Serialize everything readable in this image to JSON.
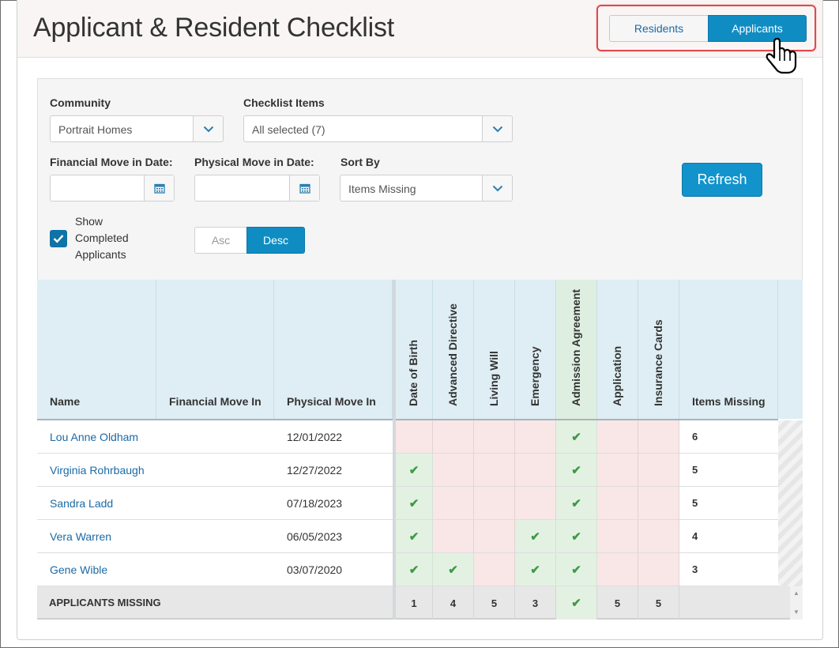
{
  "page_title": "Applicant & Resident Checklist",
  "view_toggle": {
    "residents": "Residents",
    "applicants": "Applicants",
    "active": "Applicants"
  },
  "filters": {
    "community_label": "Community",
    "community_value": "Portrait Homes",
    "checklist_label": "Checklist Items",
    "checklist_value": "All selected (7)",
    "financial_label": "Financial Move in Date:",
    "financial_value": "",
    "physical_label": "Physical Move in Date:",
    "physical_value": "",
    "sortby_label": "Sort By",
    "sortby_value": "Items Missing",
    "show_completed_label": "Show Completed Applicants",
    "show_completed_checked": true,
    "asc_label": "Asc",
    "desc_label": "Desc",
    "sort_active": "Desc",
    "refresh_label": "Refresh"
  },
  "table": {
    "columns": {
      "name": "Name",
      "financial": "Financial Move In",
      "physical": "Physical Move In",
      "items_missing": "Items Missing"
    },
    "checklist_columns": [
      "Date of Birth",
      "Advanced Directive",
      "Living Will",
      "Emergency",
      "Admission Agreement",
      "Application",
      "Insurance Cards"
    ],
    "rows": [
      {
        "name": "Lou Anne Oldham",
        "financial": "",
        "physical": "12/01/2022",
        "checks": [
          false,
          false,
          false,
          false,
          true,
          false,
          false
        ],
        "missing": "6"
      },
      {
        "name": "Virginia Rohrbaugh",
        "financial": "",
        "physical": "12/27/2022",
        "checks": [
          true,
          false,
          false,
          false,
          true,
          false,
          false
        ],
        "missing": "5"
      },
      {
        "name": "Sandra Ladd",
        "financial": "",
        "physical": "07/18/2023",
        "checks": [
          true,
          false,
          false,
          false,
          true,
          false,
          false
        ],
        "missing": "5"
      },
      {
        "name": "Vera Warren",
        "financial": "",
        "physical": "06/05/2023",
        "checks": [
          true,
          false,
          false,
          true,
          true,
          false,
          false
        ],
        "missing": "4"
      },
      {
        "name": "Gene Wible",
        "financial": "",
        "physical": "03/07/2020",
        "checks": [
          true,
          true,
          false,
          true,
          true,
          false,
          false
        ],
        "missing": "3"
      }
    ],
    "footer": {
      "label": "APPLICANTS MISSING",
      "values": [
        "1",
        "4",
        "5",
        "3",
        "",
        "5",
        "5"
      ],
      "complete": [
        false,
        false,
        false,
        false,
        true,
        false,
        false
      ]
    }
  },
  "colors": {
    "accent": "#0f8dc3",
    "highlight": "#e0494d",
    "missing": "#f9e6e6",
    "complete": "#e3f1e3",
    "check": "#3f9a45"
  }
}
